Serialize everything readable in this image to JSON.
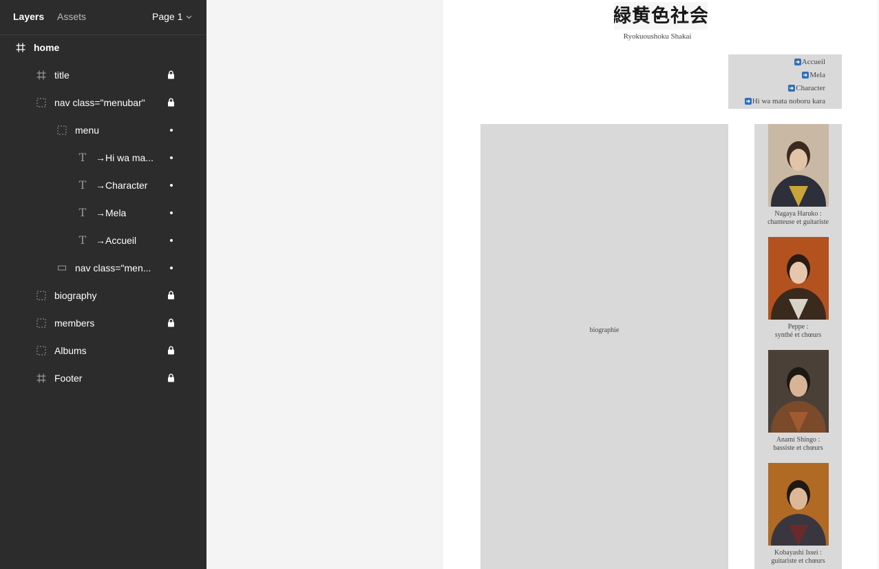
{
  "sidebar": {
    "tabs": {
      "layers": "Layers",
      "assets": "Assets"
    },
    "page_selector": "Page 1",
    "layers": [
      {
        "label": "home",
        "type": "frame",
        "depth": 0,
        "state": "none",
        "bold": true
      },
      {
        "label": "title",
        "type": "frame",
        "depth": 1,
        "state": "locked"
      },
      {
        "label": "nav class=\"menubar\"",
        "type": "group",
        "depth": 1,
        "state": "locked"
      },
      {
        "label": "menu",
        "type": "group",
        "depth": 2,
        "state": "dot"
      },
      {
        "label": "→Hi wa ma...",
        "type": "text",
        "depth": 3,
        "state": "dot"
      },
      {
        "label": "→Character",
        "type": "text",
        "depth": 3,
        "state": "dot"
      },
      {
        "label": "→Mela",
        "type": "text",
        "depth": 3,
        "state": "dot"
      },
      {
        "label": "→Accueil",
        "type": "text",
        "depth": 3,
        "state": "dot"
      },
      {
        "label": "nav class=\"men...",
        "type": "rect",
        "depth": 2,
        "state": "dot"
      },
      {
        "label": "biography",
        "type": "group",
        "depth": 1,
        "state": "locked"
      },
      {
        "label": "members",
        "type": "group",
        "depth": 1,
        "state": "locked"
      },
      {
        "label": "Albums",
        "type": "group",
        "depth": 1,
        "state": "locked"
      },
      {
        "label": "Footer",
        "type": "frame",
        "depth": 1,
        "state": "locked"
      }
    ]
  },
  "design": {
    "logo_text": "緑黄色社会",
    "subtitle": "Ryokuoushoku Shakai",
    "menu": [
      "Accueil",
      "Mela",
      "Character",
      "Hi wa mata noboru kara"
    ],
    "biography_label": "biographie",
    "members": [
      {
        "name": "Nagaya Haruko :",
        "role": "chanteuse et guitariste"
      },
      {
        "name": "Peppe :",
        "role": "synthé et chœurs"
      },
      {
        "name": "Anami Shingo :",
        "role": "bassiste et chœurs"
      },
      {
        "name": "Kobayashi Issei :",
        "role": "guitariste et chœurs"
      }
    ]
  },
  "colors": {
    "sidebar_bg": "#2c2c2c",
    "canvas_bg": "#f4f4f4",
    "placeholder_gray": "#d9d9d9",
    "menu_arrow": "#2f6fbd"
  }
}
